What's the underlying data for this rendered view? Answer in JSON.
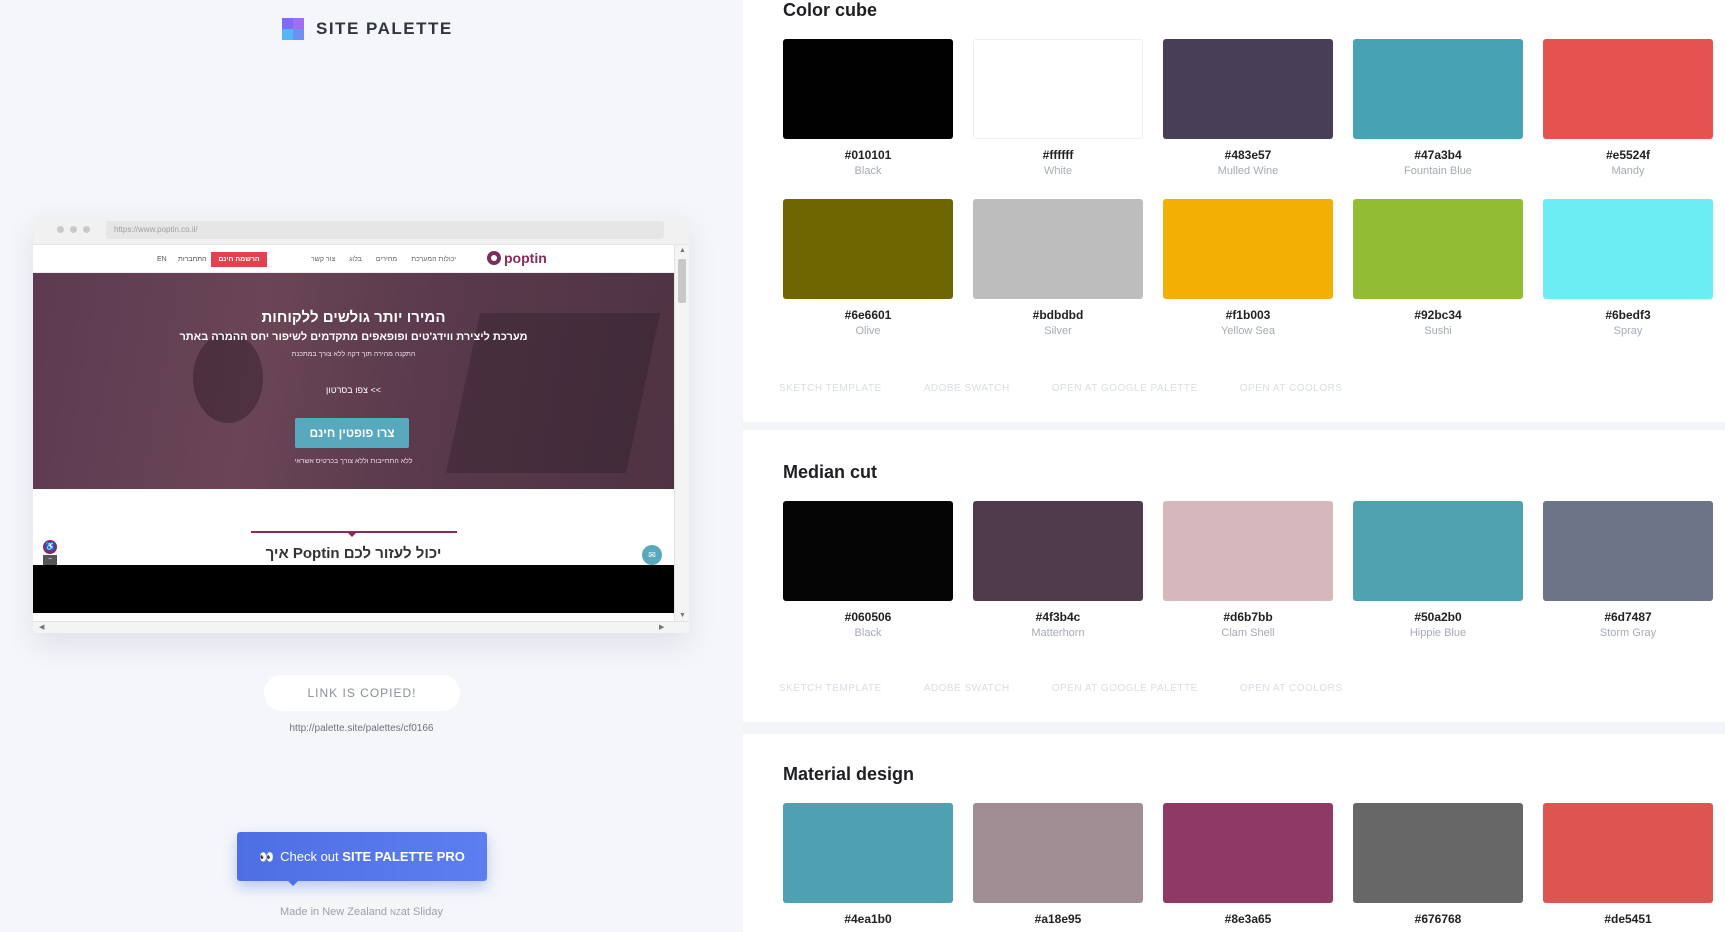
{
  "brand": {
    "name": "SITE PALETTE"
  },
  "preview": {
    "url": "https://www.poptin.co.il/",
    "site": {
      "lang": "EN",
      "login": "התחברות",
      "signup": "הרשמה חינם",
      "menu": [
        "צור קשר",
        "בלוג",
        "מחירים",
        "יכולות המערכת"
      ],
      "brand_name": "poptin",
      "hero_title": "המירו יותר גולשים ללקוחות",
      "hero_subtitle": "מערכת ליצירת ווידג'טים ופופאפים מתקדמים לשיפור יחס ההמרה באתר",
      "hero_small": "התקנה מהירה תוך דקה ללא צורך במתכנת",
      "hero_video": "צפו בסרטון <<",
      "hero_cta": "צרו פופטין חינם",
      "hero_note": "ללא התחייבות וללא צורך בכרטיס אשראי",
      "help_title": "איך Poptin יכול לעזור לכם"
    }
  },
  "share": {
    "copied_label": "LINK IS COPIED!",
    "url": "http://palette.site/palettes/cf0166"
  },
  "pro_button": {
    "prefix": "Check out",
    "name": "SITE PALETTE PRO"
  },
  "footer": {
    "made": "Made in New Zealand",
    "nz": "NZ",
    "at": "at Sliday"
  },
  "actions": [
    "SKETCH TEMPLATE",
    "ADOBE SWATCH",
    "OPEN AT GOOGLE PALETTE",
    "OPEN AT COOLORS"
  ],
  "sections": [
    {
      "title": "Color cube",
      "swatches": [
        {
          "hex": "#010101",
          "name": "Black"
        },
        {
          "hex": "#ffffff",
          "name": "White"
        },
        {
          "hex": "#483e57",
          "name": "Mulled Wine"
        },
        {
          "hex": "#47a3b4",
          "name": "Fountain Blue"
        },
        {
          "hex": "#e5524f",
          "name": "Mandy"
        },
        {
          "hex": "#6e6601",
          "name": "Olive"
        },
        {
          "hex": "#bdbdbd",
          "name": "Silver"
        },
        {
          "hex": "#f1b003",
          "name": "Yellow Sea"
        },
        {
          "hex": "#92bc34",
          "name": "Sushi"
        },
        {
          "hex": "#6bedf3",
          "name": "Spray"
        }
      ]
    },
    {
      "title": "Median cut",
      "swatches": [
        {
          "hex": "#060506",
          "name": "Black"
        },
        {
          "hex": "#4f3b4c",
          "name": "Matterhorn"
        },
        {
          "hex": "#d6b7bb",
          "name": "Clam Shell"
        },
        {
          "hex": "#50a2b0",
          "name": "Hippie Blue"
        },
        {
          "hex": "#6d7487",
          "name": "Storm Gray"
        }
      ]
    },
    {
      "title": "Material design",
      "swatches": [
        {
          "hex": "#4ea1b0",
          "name": ""
        },
        {
          "hex": "#a18e95",
          "name": ""
        },
        {
          "hex": "#8e3a65",
          "name": ""
        },
        {
          "hex": "#676768",
          "name": ""
        },
        {
          "hex": "#de5451",
          "name": ""
        }
      ]
    }
  ]
}
